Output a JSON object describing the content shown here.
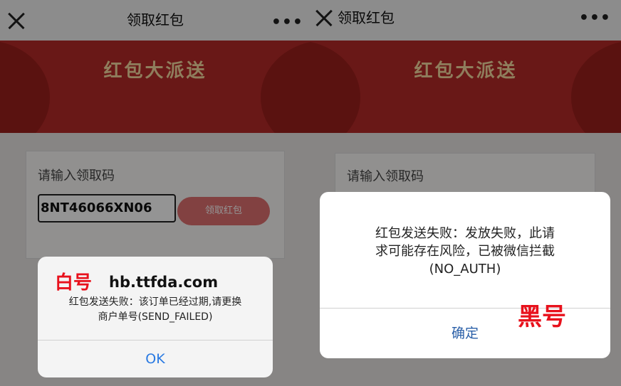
{
  "left": {
    "nav": {
      "title": "领取红包",
      "more": "•••"
    },
    "banner_title": "红包大派送",
    "form": {
      "label": "请输入领取码",
      "code_value": "8NT46066XN06",
      "claim_button": "领取红包"
    },
    "dialog": {
      "tag": "白号",
      "domain": "hb.ttfda.com",
      "message_line1": "红包发送失败：该订单已经过期,请更换",
      "message_line2": "商户单号(SEND_FAILED)",
      "ok_button": "OK"
    }
  },
  "right": {
    "nav": {
      "title": "领取红包",
      "more": "•••"
    },
    "banner_title": "红包大派送",
    "form": {
      "label": "请输入领取码"
    },
    "dialog": {
      "message_line1": "红包发送失败：发放失败，此请",
      "message_line2": "求可能存在风险，已被微信拦截",
      "message_line3": "(NO_AUTH)",
      "confirm_button": "确定",
      "tag": "黑号"
    }
  },
  "colors": {
    "accent_red": "#e8111c",
    "link_blue": "#2a7ae2",
    "banner_red": "#b52a28"
  }
}
